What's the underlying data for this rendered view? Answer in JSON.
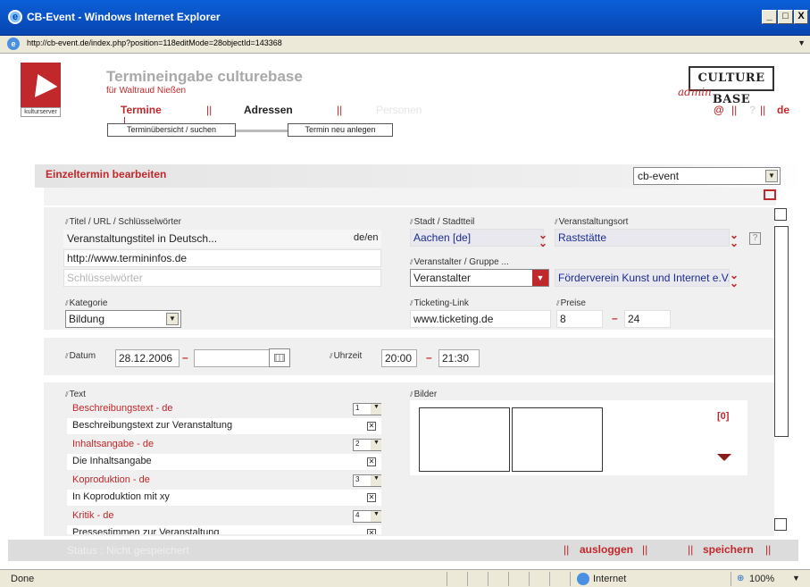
{
  "window": {
    "title": "CB-Event - Windows Internet Explorer",
    "url": "http://cb-event.de/index.php?position=118editMode=28objectId=143368",
    "min": "_",
    "max": "□",
    "close": "X"
  },
  "header": {
    "title": "Termineingabe culturebase",
    "subtitle": "für  Waltraud Nießen",
    "logo_label": "kulturserver",
    "brand": "CULTURE BASE",
    "brand_sub": "admin"
  },
  "nav": {
    "tabs": [
      {
        "label": "Termine"
      },
      {
        "label": "Adressen"
      },
      {
        "label": "Personen"
      }
    ],
    "sep": "||",
    "right": {
      "at": "@",
      "help": "?",
      "lang": "de",
      "sep": "||"
    }
  },
  "subnav": {
    "items": [
      {
        "label": "Terminübersicht / suchen"
      },
      {
        "label": "Termin neu anlegen"
      }
    ]
  },
  "section": {
    "title": "Einzeltermin bearbeiten",
    "mandant": "cb-event"
  },
  "fields": {
    "titel_label": "Titel / URL / Schlüsselwörter",
    "titel_value": "Veranstaltungstitel in Deutsch...",
    "titel_lang": "de/en",
    "url_value": "http://www.termininfos.de",
    "keywords_placeholder": "Schlüsselwörter",
    "kategorie_label": "Kategorie",
    "kategorie_value": "Bildung",
    "stadt_label": "Stadt / Stadtteil",
    "stadt_value": "Aachen [de]",
    "ort_label": "Veranstaltungsort",
    "ort_value": "Raststätte",
    "help": "?",
    "veranstalter_label": "Veranstalter / Gruppe ...",
    "veranstalter_type": "Veranstalter",
    "veranstalter_value": "Förderverein Kunst und Internet e.V.",
    "ticket_label": "Ticketing-Link",
    "ticket_value": "www.ticketing.de",
    "preise_label": "Preise",
    "preis_min": "8",
    "preis_max": "24",
    "dash": "–",
    "datum_label": "Datum",
    "datum_from": "28.12.2006",
    "datum_to": "",
    "uhrzeit_label": "Uhrzeit",
    "zeit_from": "20:00",
    "zeit_to": "21:30"
  },
  "text_section": {
    "label": "Text",
    "items": [
      {
        "title": "Beschreibungstext  - de",
        "value": "Beschreibungstext zur Veranstaltung",
        "num": "1"
      },
      {
        "title": "Inhaltsangabe  - de",
        "value": "Die Inhaltsangabe",
        "num": "2"
      },
      {
        "title": "Koproduktion  - de",
        "value": "In Koproduktion mit xy",
        "num": "3"
      },
      {
        "title": "Kritik  - de",
        "value": "Pressestimmen zur Veranstaltung",
        "num": "4"
      }
    ]
  },
  "images": {
    "label": "Bilder",
    "count": "[0]"
  },
  "footer": {
    "status": "Status : Nicht gespeichert",
    "logout": "ausloggen",
    "save": "speichern",
    "sep": "||"
  },
  "statusbar": {
    "left": "Done",
    "zone": "Internet",
    "zoom": "100%"
  }
}
